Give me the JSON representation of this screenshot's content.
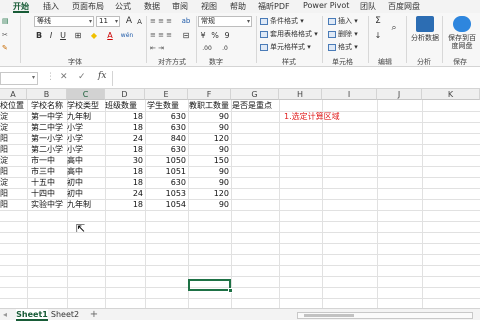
{
  "ribbon_tabs": [
    "开始",
    "插入",
    "页面布局",
    "公式",
    "数据",
    "审阅",
    "视图",
    "帮助",
    "福昕PDF",
    "Power Pivot",
    "团队",
    "百度网盘"
  ],
  "font": {
    "name": "等线",
    "size": "11",
    "increase": "A",
    "decrease": "A",
    "bold": "B",
    "italic": "I",
    "underline": "U",
    "border": "⊞",
    "fill": "◆",
    "color": "A",
    "style_code": "wén",
    "group_label": "字体"
  },
  "alignment": {
    "wrap": "ab",
    "merge": "⊟",
    "group_label": "对齐方式"
  },
  "number": {
    "format": "常规",
    "currency": "¥",
    "percent": "%",
    "comma": "9",
    "inc_decimal": ".00",
    "dec_decimal": ".0",
    "group_label": "数字"
  },
  "styles": {
    "conditional": "条件格式",
    "table": "套用表格格式",
    "cell": "单元格样式",
    "group_label": "样式"
  },
  "cells": {
    "insert": "插入",
    "delete": "删除",
    "format": "格式",
    "group_label": "单元格"
  },
  "editing": {
    "sum": "Σ",
    "sort": "↓",
    "find": "⌕",
    "group_label": "编辑"
  },
  "analysis": {
    "analyze": "分析数据",
    "group_label": "分析"
  },
  "baidu": {
    "save": "保存到百度网盘",
    "group_label": "保存"
  },
  "formula_bar": {
    "cancel": "✕",
    "confirm": "✓",
    "fx": "fx",
    "value": ""
  },
  "columns": [
    "A",
    "B",
    "C",
    "D",
    "E",
    "F",
    "G",
    "H",
    "I",
    "J",
    "K"
  ],
  "headers": [
    "学校位置",
    "学校名称",
    "学校类型",
    "班级数量",
    "学生数量",
    "教职工数量",
    "是否是重点"
  ],
  "rows": [
    [
      "海淀",
      "第一中学",
      "九年制",
      "18",
      "630",
      "90"
    ],
    [
      "海淀",
      "第二中学",
      "小学",
      "18",
      "630",
      "90"
    ],
    [
      "朝阳",
      "第一小学",
      "小学",
      "24",
      "840",
      "120"
    ],
    [
      "朝阳",
      "第二小学",
      "小学",
      "18",
      "630",
      "90"
    ],
    [
      "海淀",
      "市一中",
      "高中",
      "30",
      "1050",
      "150"
    ],
    [
      "朝阳",
      "市三中",
      "高中",
      "18",
      "1051",
      "90"
    ],
    [
      "海淀",
      "十五中",
      "初中",
      "18",
      "630",
      "90"
    ],
    [
      "朝阳",
      "十四中",
      "初中",
      "24",
      "1053",
      "120"
    ],
    [
      "朝阳",
      "实验中学",
      "九年制",
      "18",
      "1054",
      "90"
    ]
  ],
  "annotation": "1.选定计算区域",
  "sheets": [
    "Sheet1",
    "Sheet2",
    "+"
  ],
  "colors": {
    "accent": "#185c37",
    "annotation": "#e02020"
  }
}
